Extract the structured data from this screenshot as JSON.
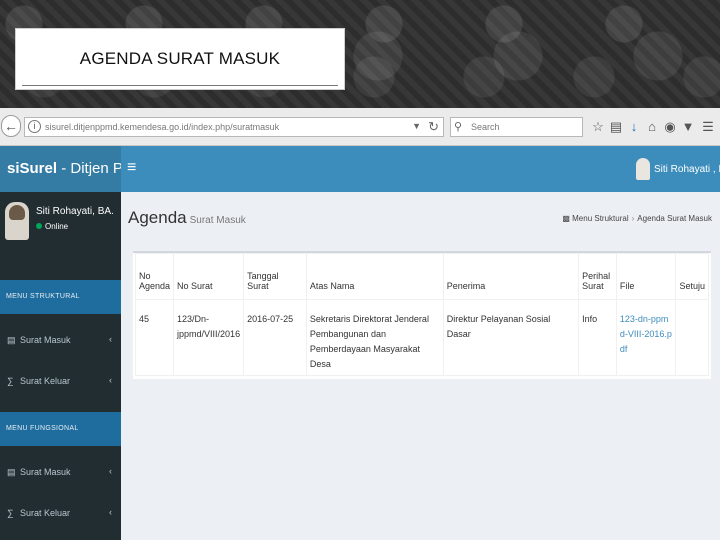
{
  "slide": {
    "title": "AGENDA SURAT MASUK"
  },
  "browser": {
    "url": "sisurel.ditjenppmd.kemendesa.go.id/index.php/suratmasuk",
    "search_placeholder": "Search",
    "tool_icons": [
      "star-icon",
      "clipboard-icon",
      "download-icon",
      "home-icon",
      "pocket-icon",
      "shield-icon",
      "menu-icon"
    ]
  },
  "app": {
    "logo_bold": "siSurel",
    "logo_rest": " - Ditjen PPMD",
    "user_name_top": "Siti Rohayati , BA.",
    "colors": {
      "logo_bg": "#357ca5",
      "topbar_bg": "#3c8dbc",
      "sidebar_bg": "#222d32",
      "menu_header_bg": "#1e6d9e",
      "online": "#00a65a"
    }
  },
  "sidebar": {
    "user_name": "Siti Rohayati, BA.",
    "status": "Online",
    "sections": [
      {
        "header": "MENU STRUKTURAL",
        "items": [
          {
            "label": "Surat Masuk",
            "icon": "inbox-icon"
          },
          {
            "label": "Surat Keluar",
            "icon": "outbox-icon"
          }
        ]
      },
      {
        "header": "MENU FUNGSIONAL",
        "items": [
          {
            "label": "Surat Masuk",
            "icon": "inbox-icon"
          },
          {
            "label": "Surat Keluar",
            "icon": "outbox-icon"
          }
        ]
      }
    ]
  },
  "content": {
    "title": "Agenda",
    "subtitle": "Surat Masuk",
    "breadcrumb": [
      "Menu Struktural",
      "Agenda Surat Masuk"
    ],
    "table": {
      "headers": [
        [
          "No",
          "Agenda"
        ],
        [
          "No Surat"
        ],
        [
          "Tanggal",
          "Surat"
        ],
        [
          "Atas Nama"
        ],
        [
          "Penerima"
        ],
        [
          "Perihal",
          "Surat"
        ],
        [
          "File"
        ],
        [
          "Setuju"
        ]
      ],
      "rows": [
        {
          "no_agenda": "45",
          "no_surat": "123/Dn-jppmd/VIII/2016",
          "tanggal": "2016-07-25",
          "atas_nama": "Sekretaris Direktorat Jenderal Pembangunan dan Pemberdayaan Masyarakat Desa",
          "penerima": "Direktur Pelayanan Sosial Dasar",
          "perihal": "Info",
          "file": "123-dn-ppmd-VIII-2016.pdf",
          "setuju": ""
        }
      ]
    }
  }
}
